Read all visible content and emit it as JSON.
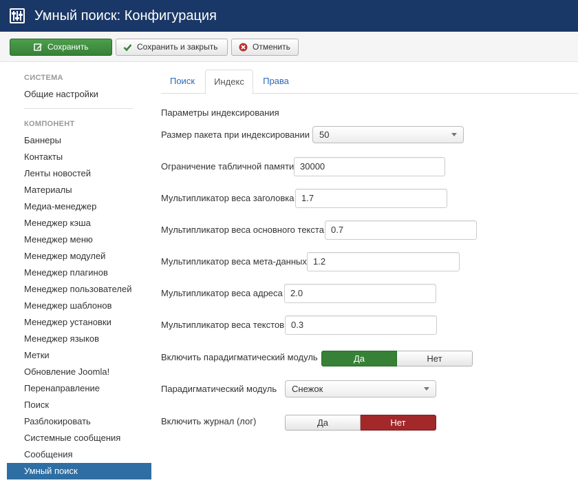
{
  "header": {
    "title": "Умный поиск: Конфигурация",
    "icon": "equalizer-icon"
  },
  "toolbar": {
    "save_label": "Сохранить",
    "save_close_label": "Сохранить и закрыть",
    "cancel_label": "Отменить"
  },
  "sidebar": {
    "system_heading": "СИСТЕМА",
    "system_items": [
      "Общие настройки"
    ],
    "component_heading": "КОМПОНЕНТ",
    "items": [
      "Баннеры",
      "Контакты",
      "Ленты новостей",
      "Материалы",
      "Медиа-менеджер",
      "Менеджер кэша",
      "Менеджер меню",
      "Менеджер модулей",
      "Менеджер плагинов",
      "Менеджер пользователей",
      "Менеджер шаблонов",
      "Менеджер установки",
      "Менеджер языков",
      "Метки",
      "Обновление Joomla!",
      "Перенаправление",
      "Поиск",
      "Разблокировать",
      "Системные сообщения",
      "Сообщения",
      "Умный поиск"
    ],
    "active_item": "Умный поиск"
  },
  "tabs": [
    "Поиск",
    "Индекс",
    "Права"
  ],
  "active_tab": "Индекс",
  "form": {
    "legend": "Параметры индексирования",
    "batch_size": {
      "label": "Размер пакета при индексировании",
      "value": "50"
    },
    "memory_limit": {
      "label": "Ограничение табличной памяти",
      "value": "30000"
    },
    "title_multiplier": {
      "label": "Мультипликатор веса заголовка",
      "value": "1.7"
    },
    "text_multiplier": {
      "label": "Мультипликатор веса основного текста",
      "value": "0.7"
    },
    "meta_multiplier": {
      "label": "Мультипликатор веса мета-данных",
      "value": "1.2"
    },
    "path_multiplier": {
      "label": "Мультипликатор веса адреса",
      "value": "2.0"
    },
    "misc_multiplier": {
      "label": "Мультипликатор веса текстов",
      "value": "0.3"
    },
    "stemmer_enable": {
      "label": "Включить парадигматический модуль",
      "yes": "Да",
      "no": "Нет",
      "selected": "Да"
    },
    "stemmer": {
      "label": "Парадигматический модуль",
      "value": "Снежок"
    },
    "log_enable": {
      "label": "Включить журнал (лог)",
      "yes": "Да",
      "no": "Нет",
      "selected": "Нет"
    }
  },
  "colors": {
    "header_bg": "#1a3867",
    "save_green": "#378137",
    "active_blue": "#2f6ea2",
    "no_red": "#a2282a",
    "link_blue": "#2a69b8"
  }
}
